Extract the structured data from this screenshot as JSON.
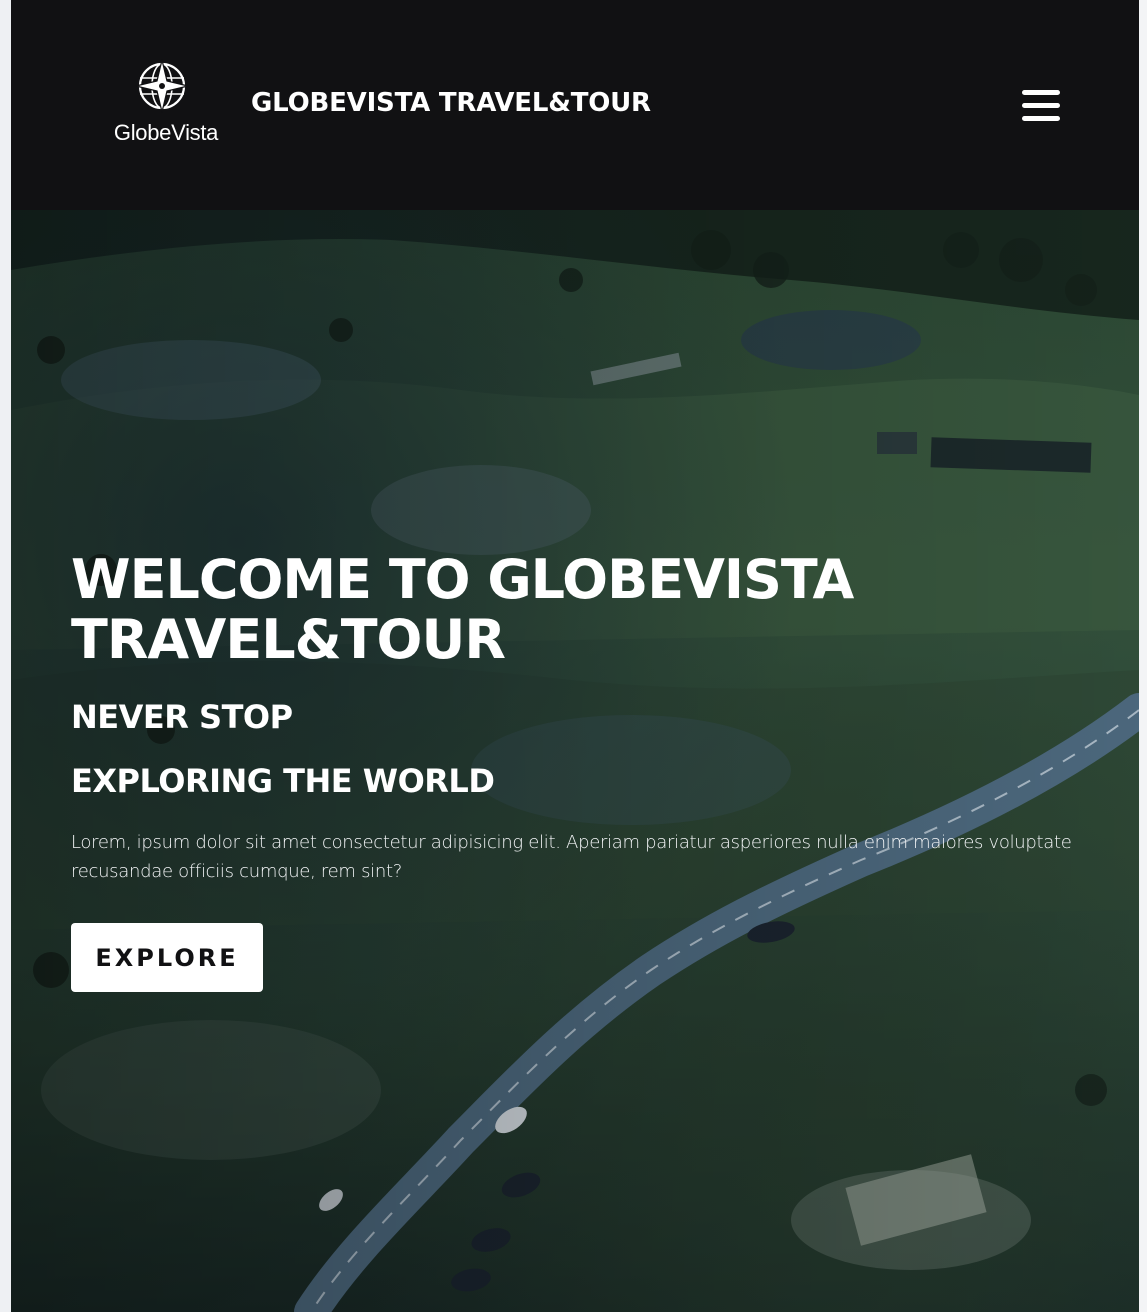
{
  "header": {
    "logo_text": "GlobeVista",
    "brand_title": "GLOBEVISTA TRAVEL&TOUR",
    "menu_icon": "hamburger-menu-icon",
    "background_color": "#111113"
  },
  "hero": {
    "title_line1": "WELCOME TO GLOBEVISTA",
    "title_line2": "TRAVEL&TOUR",
    "subtitle_line1": "NEVER STOP",
    "subtitle_line2": "EXPLORING THE WORLD",
    "description": "Lorem, ipsum dolor sit amet consectetur adipisicing elit. Aperiam pariatur asperiores nulla enim maiores voluptate recusandae officiis cumque, rem sint?",
    "cta_label": "EXPLORE",
    "background_image": "aerial-valley-road-photo"
  },
  "colors": {
    "text": "#ffffff",
    "button_bg": "#ffffff",
    "button_text": "#111113"
  }
}
